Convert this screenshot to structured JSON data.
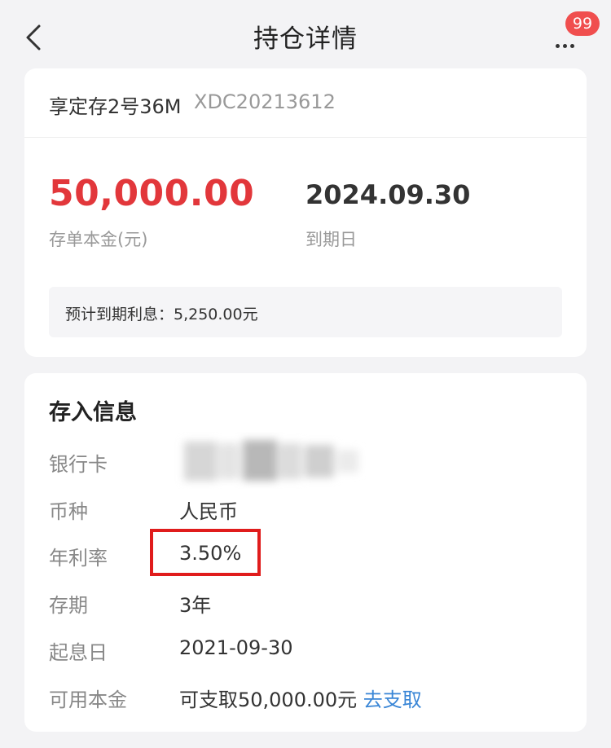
{
  "nav": {
    "title": "持仓详情",
    "badge_count": "99"
  },
  "product": {
    "name": "享定存2号36M",
    "code": "XDC20213612"
  },
  "summary": {
    "principal_value": "50,000.00",
    "principal_label": "存单本金(元)",
    "maturity_value": "2024.09.30",
    "maturity_label": "到期日",
    "interest_text": "预计到期利息：5,250.00元"
  },
  "deposit_info": {
    "title": "存入信息",
    "bank_card_label": "银行卡",
    "currency_label": "币种",
    "currency_value": "人民币",
    "rate_label": "年利率",
    "rate_value": "3.50%",
    "term_label": "存期",
    "term_value": "3年",
    "start_date_label": "起息日",
    "start_date_value": "2021-09-30",
    "available_label": "可用本金",
    "available_value": "可支取50,000.00元",
    "withdraw_link": "去支取"
  },
  "colors": {
    "principal": "#e2373b",
    "link": "#3a86d6",
    "badge": "#f04e4e",
    "highlight": "#e01c1c"
  },
  "icons": {
    "back": "chevron-left-icon",
    "more": "more-dots-icon"
  }
}
